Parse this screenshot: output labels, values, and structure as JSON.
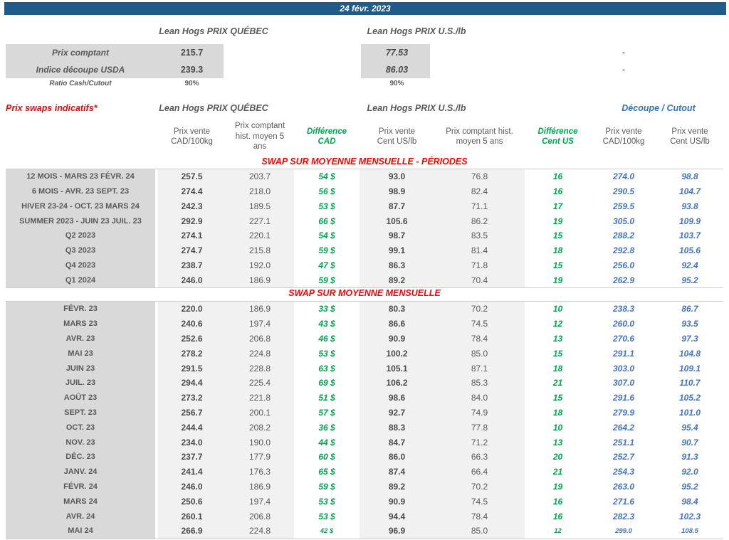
{
  "colors": {
    "title_bar_bg": "#1F5C8C",
    "accent_red": "#FF0000",
    "accent_green": "#00A550",
    "header_blue": "#2E73C8",
    "value_blue": "#4472C4",
    "text_gray": "#595959",
    "label_bg": "#D9D9D9",
    "data_bg": "#F1F1F1"
  },
  "title_bar": {
    "date": "24 févr. 2023"
  },
  "top": {
    "quebec_header": "Lean Hogs PRIX QUÉBEC",
    "us_header": "Lean Hogs PRIX U.S./lb",
    "rows": [
      {
        "label": "Prix comptant",
        "quebec": "215.7",
        "us": "77.53",
        "decoupe": "-"
      },
      {
        "label": "Indice découpe USDA",
        "quebec": "239.3",
        "us": "86.03",
        "decoupe": "-"
      },
      {
        "label": "Ratio Cash/Cutout",
        "quebec": "90%",
        "us": "90%",
        "decoupe": ""
      }
    ]
  },
  "swaps": {
    "title": "Prix swaps indicatifs*",
    "quebec_header": "Lean Hogs PRIX QUÉBEC",
    "us_header": "Lean Hogs PRIX U.S./lb",
    "decoupe_header": "Découpe / Cutout",
    "columns": [
      {
        "id": "prix-vente-cad",
        "label": "Prix vente\nCAD/100kg"
      },
      {
        "id": "prix-comptant-hist-cad",
        "label": "Prix comptant\nhist. moyen 5\nans"
      },
      {
        "id": "difference-cad",
        "label": "Différence\nCAD"
      },
      {
        "id": "prix-vente-cent-us",
        "label": "Prix vente\nCent US/lb"
      },
      {
        "id": "prix-comptant-hist-us",
        "label": "Prix comptant hist.\nmoyen 5 ans"
      },
      {
        "id": "difference-cent-us",
        "label": "Différence\nCent US"
      },
      {
        "id": "decoupe-prix-vente-cad",
        "label": "Prix vente\nCAD/100kg"
      },
      {
        "id": "decoupe-prix-vente-cent-us",
        "label": "Prix vente\nCent US/lb"
      }
    ],
    "sections": [
      {
        "header": "SWAP SUR MOYENNE MENSUELLE - PÉRIODES",
        "rows": [
          {
            "label": "12 MOIS - MARS 23 FÉVR. 24",
            "values": [
              "257.5",
              "203.7",
              "54 $",
              "93.0",
              "76.8",
              "16",
              "274.0",
              "98.8"
            ]
          },
          {
            "label": "6 MOIS - AVR. 23 SEPT. 23",
            "values": [
              "274.4",
              "218.0",
              "56 $",
              "98.9",
              "82.4",
              "16",
              "290.5",
              "104.7"
            ]
          },
          {
            "label": "HIVER 23-24 - OCT. 23 MARS 24",
            "values": [
              "242.3",
              "189.5",
              "53 $",
              "87.7",
              "71.1",
              "17",
              "259.5",
              "93.8"
            ]
          },
          {
            "label": "SUMMER 2023 - JUIN 23 JUIL. 23",
            "values": [
              "292.9",
              "227.1",
              "66 $",
              "105.6",
              "86.2",
              "19",
              "305.0",
              "109.9"
            ]
          },
          {
            "label": "Q2 2023",
            "values": [
              "274.1",
              "220.1",
              "54 $",
              "98.7",
              "83.5",
              "15",
              "288.2",
              "103.7"
            ]
          },
          {
            "label": "Q3 2023",
            "values": [
              "274.7",
              "215.8",
              "59 $",
              "99.1",
              "81.4",
              "18",
              "292.8",
              "105.6"
            ]
          },
          {
            "label": "Q4 2023",
            "values": [
              "238.7",
              "192.0",
              "47 $",
              "86.3",
              "71.8",
              "15",
              "256.0",
              "92.4"
            ]
          },
          {
            "label": "Q1 2024",
            "values": [
              "246.0",
              "186.9",
              "59 $",
              "89.2",
              "70.4",
              "19",
              "262.9",
              "95.2"
            ]
          }
        ]
      },
      {
        "header": "SWAP SUR MOYENNE MENSUELLE",
        "rows": [
          {
            "label": "FÉVR. 23",
            "values": [
              "220.0",
              "186.9",
              "33 $",
              "80.3",
              "70.2",
              "10",
              "238.3",
              "86.7"
            ]
          },
          {
            "label": "MARS 23",
            "values": [
              "240.6",
              "197.4",
              "43 $",
              "86.6",
              "74.5",
              "12",
              "260.0",
              "93.5"
            ]
          },
          {
            "label": "AVR. 23",
            "values": [
              "252.6",
              "206.8",
              "46 $",
              "90.9",
              "78.4",
              "13",
              "270.6",
              "97.3"
            ]
          },
          {
            "label": "MAI 23",
            "values": [
              "278.2",
              "224.8",
              "53 $",
              "100.2",
              "85.0",
              "15",
              "291.1",
              "104.8"
            ]
          },
          {
            "label": "JUIN 23",
            "values": [
              "291.5",
              "228.8",
              "63 $",
              "105.1",
              "87.1",
              "18",
              "303.0",
              "109.1"
            ]
          },
          {
            "label": "JUIL. 23",
            "values": [
              "294.4",
              "225.4",
              "69 $",
              "106.2",
              "85.3",
              "21",
              "307.0",
              "110.7"
            ]
          },
          {
            "label": "AOÛT 23",
            "values": [
              "273.2",
              "221.8",
              "51 $",
              "98.6",
              "84.0",
              "15",
              "291.6",
              "105.2"
            ]
          },
          {
            "label": "SEPT. 23",
            "values": [
              "256.7",
              "200.1",
              "57 $",
              "92.7",
              "74.9",
              "18",
              "279.9",
              "101.0"
            ]
          },
          {
            "label": "OCT. 23",
            "values": [
              "244.4",
              "208.2",
              "36 $",
              "88.3",
              "77.8",
              "10",
              "264.2",
              "95.4"
            ]
          },
          {
            "label": "NOV. 23",
            "values": [
              "234.0",
              "190.0",
              "44 $",
              "84.7",
              "71.2",
              "13",
              "251.1",
              "90.7"
            ]
          },
          {
            "label": "DÉC. 23",
            "values": [
              "237.7",
              "177.9",
              "60 $",
              "86.0",
              "66.3",
              "20",
              "252.7",
              "91.3"
            ]
          },
          {
            "label": "JANV. 24",
            "values": [
              "241.4",
              "176.3",
              "65 $",
              "87.4",
              "66.4",
              "21",
              "254.3",
              "92.0"
            ]
          },
          {
            "label": "FÉVR. 24",
            "values": [
              "246.0",
              "186.9",
              "59 $",
              "89.2",
              "70.2",
              "19",
              "263.0",
              "95.2"
            ]
          },
          {
            "label": "MARS 24",
            "values": [
              "250.6",
              "197.4",
              "53 $",
              "90.9",
              "74.5",
              "16",
              "271.6",
              "98.4"
            ]
          },
          {
            "label": "AVR. 24",
            "values": [
              "260.1",
              "206.8",
              "53 $",
              "94.4",
              "78.4",
              "16",
              "282.3",
              "102.3"
            ]
          },
          {
            "label": "MAI 24",
            "values": [
              "266.9",
              "224.8",
              "42 $",
              "96.9",
              "85.0",
              "12",
              "299.0",
              "108.5"
            ],
            "small": [
              2,
              5,
              6,
              7
            ]
          }
        ]
      }
    ]
  }
}
